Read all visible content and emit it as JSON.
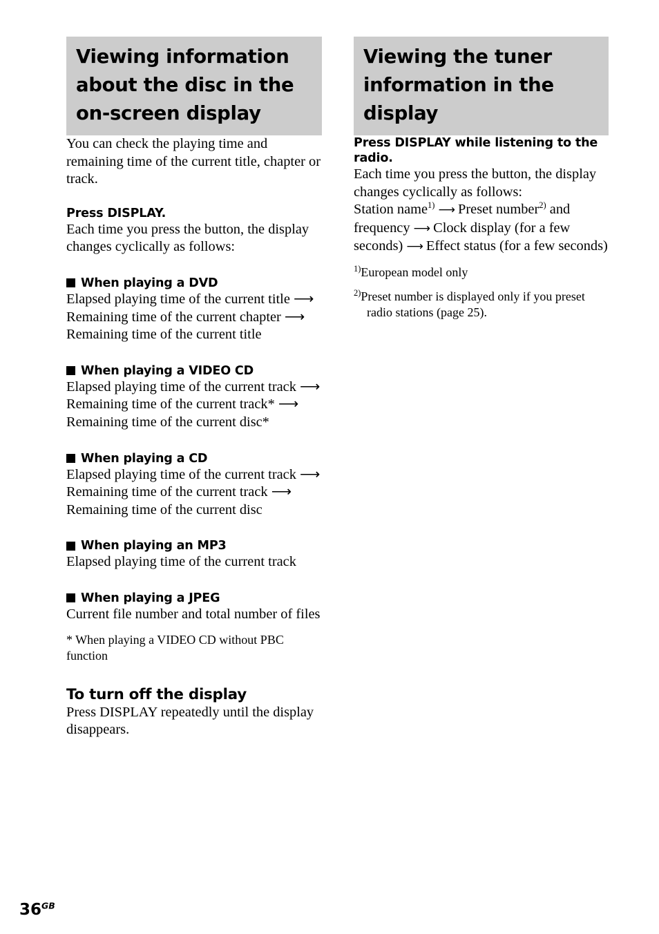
{
  "page": {
    "number": "36",
    "region_suffix": "GB",
    "background_color": "#ffffff",
    "heading_banner_color": "#cccccc",
    "text_color": "#000000"
  },
  "left_column": {
    "heading": "Viewing information about the disc in the on-screen display",
    "intro": "You can check the playing time and remaining time of the current title, chapter or track.",
    "lead": "Press DISPLAY.",
    "lead_body": "Each time you press the button, the display changes cyclically as follows:",
    "sections": [
      {
        "bullet": "black-square",
        "title": "When playing a DVD",
        "body": "Elapsed playing time of the current title ⟶ Remaining time of the current chapter ⟶ Remaining time of the current title"
      },
      {
        "bullet": "black-square",
        "title": "When playing a VIDEO CD",
        "body": "Elapsed playing time of the current track ⟶ Remaining time of the current track* ⟶ Remaining time of the current disc*"
      },
      {
        "bullet": "black-square",
        "title": "When playing a CD",
        "body": "Elapsed playing time of the current track ⟶ Remaining time of the current track ⟶ Remaining time of the current disc"
      },
      {
        "bullet": "black-square",
        "title": "When playing an MP3",
        "body": "Elapsed playing time of the current track"
      },
      {
        "bullet": "black-square",
        "title": "When playing a JPEG",
        "body": "Current file number and total number of files"
      }
    ],
    "asterisk_note": "* When playing a VIDEO CD without PBC function",
    "turn_off_heading": "To turn off the display",
    "turn_off_body": "Press DISPLAY repeatedly until the display disappears."
  },
  "right_column": {
    "heading": "Viewing the tuner information in the display",
    "lead": "Press DISPLAY while listening to the radio.",
    "lead_body": "Each time you press the button, the display changes cyclically as follows:",
    "cycle": {
      "part1": "Station name",
      "ref1": "1)",
      "arrow1": "⟶",
      "part2": "Preset number",
      "ref2": "2)",
      "part3": " and frequency ",
      "arrow2": "⟶",
      "part4": " Clock display (for a few seconds) ",
      "arrow3": "⟶",
      "part5": " Effect status (for a few seconds)"
    },
    "footnotes": [
      {
        "mark": "1)",
        "text": "European model only"
      },
      {
        "mark": "2)",
        "text": "Preset number is displayed only if you preset radio stations (page 25)."
      }
    ]
  }
}
